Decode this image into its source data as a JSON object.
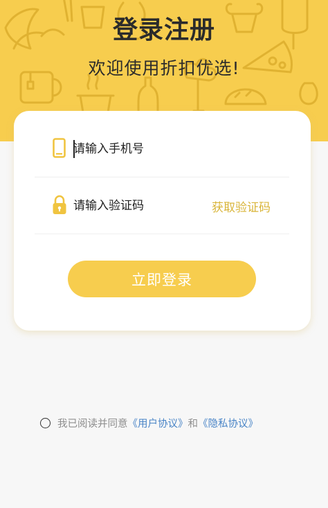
{
  "header": {
    "title": "登录注册",
    "subtitle": "欢迎使用折扣优选!"
  },
  "form": {
    "phone_placeholder": "请输入手机号",
    "code_placeholder": "请输入验证码",
    "get_code_label": "获取验证码",
    "login_label": "立即登录"
  },
  "agreement": {
    "prefix": "我已阅读并同意",
    "user_agreement": "《用户协议》",
    "conjunction": "和",
    "privacy_policy": "《隐私协议》",
    "checked": false
  },
  "colors": {
    "brand": "#f7cd4e",
    "accent_text": "#d9b53a",
    "link": "#4a85c7",
    "background": "#f7f7f7"
  },
  "icons": {
    "phone": "phone-icon",
    "lock": "lock-icon"
  }
}
